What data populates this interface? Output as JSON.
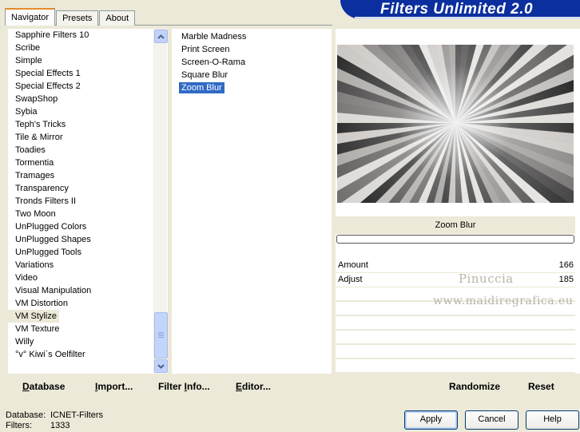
{
  "tabs": [
    {
      "label": "Navigator",
      "active": true
    },
    {
      "label": "Presets",
      "active": false
    },
    {
      "label": "About",
      "active": false
    }
  ],
  "banner": {
    "title": "Filters Unlimited 2.0"
  },
  "categories": {
    "items": [
      "Sapphire Filters 10",
      "Scribe",
      "Simple",
      "Special Effects 1",
      "Special Effects 2",
      "SwapShop",
      "Sybia",
      "Teph's Tricks",
      "Tile & Mirror",
      "Toadies",
      "Tormentia",
      "Tramages",
      "Transparency",
      "Tronds Filters II",
      "Two Moon",
      "UnPlugged Colors",
      "UnPlugged Shapes",
      "UnPlugged Tools",
      "Variations",
      "Video",
      "Visual Manipulation",
      "VM Distortion",
      "VM Stylize",
      "VM Texture",
      "Willy",
      "°v° Kiwi`s Oelfilter"
    ],
    "selected": "VM Stylize"
  },
  "filters": {
    "items": [
      "Marble Madness",
      "Print Screen",
      "Screen-O-Rama",
      "Square Blur",
      "Zoom Blur"
    ],
    "selected": "Zoom Blur"
  },
  "preview": {
    "filter_name": "Zoom Blur"
  },
  "params": [
    {
      "label": "Amount",
      "value": "166"
    },
    {
      "label": "Adjust",
      "value": "185"
    }
  ],
  "watermark": {
    "line1": "Pinuccia",
    "line2": "www.maidiregrafica.eu"
  },
  "toolbar": {
    "database": {
      "accel": "D",
      "rest": "atabase"
    },
    "import": {
      "accel": "I",
      "rest": "mport..."
    },
    "filter_info": {
      "pre": "Filter ",
      "accel": "I",
      "rest": "nfo..."
    },
    "editor": {
      "accel": "E",
      "rest": "ditor..."
    },
    "randomize": "Randomize",
    "reset": "Reset"
  },
  "footer": {
    "database_label": "Database:",
    "database_value": "ICNET-Filters",
    "filters_label": "Filters:",
    "filters_value": "1333"
  },
  "buttons": {
    "apply": "Apply",
    "cancel": "Cancel",
    "help": "Help"
  },
  "colors": {
    "selection": "#316ac5",
    "banner": "#0b2f9e",
    "tab_accent": "#e68b2c"
  }
}
